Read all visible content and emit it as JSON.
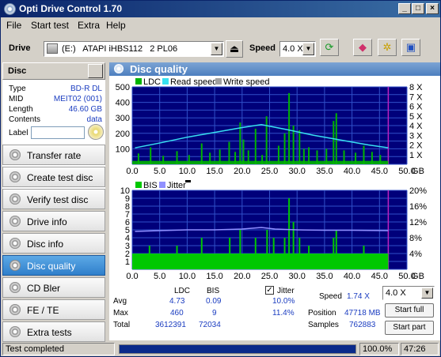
{
  "window": {
    "title": "Opti Drive Control 1.70",
    "min": "_",
    "max": "□",
    "close": "×"
  },
  "menu": [
    "File",
    "Start test",
    "Extra",
    "Help"
  ],
  "toolbar": {
    "drive_label": "Drive",
    "drive_value": "(E:)   ATAPI iHBS112   2 PL06",
    "speed_label": "Speed",
    "speed_value": "4.0 X"
  },
  "disc": {
    "header": "Disc",
    "rows": [
      {
        "key": "Type",
        "value": "BD-R DL"
      },
      {
        "key": "MID",
        "value": "MEIT02 (001)"
      },
      {
        "key": "Length",
        "value": "46.60 GB"
      },
      {
        "key": "Contents",
        "value": "data"
      }
    ],
    "label_key": "Label",
    "label_value": ""
  },
  "nav": [
    {
      "label": "Transfer rate",
      "active": false
    },
    {
      "label": "Create test disc",
      "active": false
    },
    {
      "label": "Verify test disc",
      "active": false
    },
    {
      "label": "Drive info",
      "active": false
    },
    {
      "label": "Disc info",
      "active": false
    },
    {
      "label": "Disc quality",
      "active": true
    },
    {
      "label": "CD Bler",
      "active": false
    },
    {
      "label": "FE / TE",
      "active": false
    },
    {
      "label": "Extra tests",
      "active": false
    }
  ],
  "panel_title": "Disc quality",
  "colors": {
    "ldc": "#00b400",
    "read_speed": "#38e0f0",
    "write_speed": "#a0a0a0",
    "bis": "#00c800",
    "jitter": "#9090ff",
    "plot_bg": "#00007a",
    "grid": "#3050c8"
  },
  "chart_data": [
    {
      "type": "bar",
      "legend": [
        "LDC",
        "Read speed",
        "Write speed"
      ],
      "xlabel": "GB",
      "xticks": [
        "0.0",
        "5.0",
        "10.0",
        "15.0",
        "20.0",
        "25.0",
        "30.0",
        "35.0",
        "40.0",
        "45.0",
        "50.0"
      ],
      "xlim": [
        0,
        50
      ],
      "ylim": [
        0,
        500
      ],
      "yticks": [
        "500",
        "400",
        "300",
        "200",
        "100"
      ],
      "y2ticks": [
        "8 X",
        "7 X",
        "6 X",
        "5 X",
        "4 X",
        "3 X",
        "2 X",
        "1 X"
      ],
      "y2lim": [
        0,
        8
      ],
      "ldc_spikes": [
        {
          "x": 1.0,
          "y": 70
        },
        {
          "x": 3.2,
          "y": 110
        },
        {
          "x": 5.5,
          "y": 55
        },
        {
          "x": 8.0,
          "y": 85
        },
        {
          "x": 10.2,
          "y": 60
        },
        {
          "x": 12.5,
          "y": 135
        },
        {
          "x": 14.0,
          "y": 75
        },
        {
          "x": 15.8,
          "y": 95
        },
        {
          "x": 17.5,
          "y": 145
        },
        {
          "x": 18.6,
          "y": 80
        },
        {
          "x": 19.5,
          "y": 270
        },
        {
          "x": 20.1,
          "y": 160
        },
        {
          "x": 21.0,
          "y": 90
        },
        {
          "x": 22.3,
          "y": 230
        },
        {
          "x": 23.5,
          "y": 60
        },
        {
          "x": 24.3,
          "y": 310
        },
        {
          "x": 26.5,
          "y": 120
        },
        {
          "x": 27.6,
          "y": 200
        },
        {
          "x": 28.4,
          "y": 460
        },
        {
          "x": 29.2,
          "y": 250
        },
        {
          "x": 30.3,
          "y": 220
        },
        {
          "x": 31.1,
          "y": 100
        },
        {
          "x": 32.0,
          "y": 110
        },
        {
          "x": 33.5,
          "y": 90
        },
        {
          "x": 35.2,
          "y": 100
        },
        {
          "x": 36.5,
          "y": 280
        },
        {
          "x": 37.0,
          "y": 330
        },
        {
          "x": 38.4,
          "y": 90
        },
        {
          "x": 40.5,
          "y": 75
        },
        {
          "x": 42.0,
          "y": 120
        },
        {
          "x": 43.5,
          "y": 80
        },
        {
          "x": 45.0,
          "y": 60
        }
      ],
      "ldc_baseline": 22,
      "read_speed": [
        {
          "x": 0.5,
          "y": 1.7
        },
        {
          "x": 5,
          "y": 2.2
        },
        {
          "x": 10,
          "y": 2.8
        },
        {
          "x": 15,
          "y": 3.3
        },
        {
          "x": 20,
          "y": 3.8
        },
        {
          "x": 23.5,
          "y": 4.1
        },
        {
          "x": 28,
          "y": 3.6
        },
        {
          "x": 33,
          "y": 3.0
        },
        {
          "x": 38,
          "y": 2.5
        },
        {
          "x": 43,
          "y": 2.0
        },
        {
          "x": 46.6,
          "y": 1.7
        }
      ]
    },
    {
      "type": "bar",
      "legend": [
        "BIS",
        "Jitter"
      ],
      "xlabel": "GB",
      "xticks": [
        "0.0",
        "5.0",
        "10.0",
        "15.0",
        "20.0",
        "25.0",
        "30.0",
        "35.0",
        "40.0",
        "45.0",
        "50.0"
      ],
      "xlim": [
        0,
        50
      ],
      "ylim": [
        0,
        10
      ],
      "yticks": [
        "10",
        "9",
        "8",
        "7",
        "6",
        "5",
        "4",
        "3",
        "2",
        "1"
      ],
      "y2ticks": [
        "20%",
        "16%",
        "12%",
        "8%",
        "4%"
      ],
      "y2lim": [
        0,
        20
      ],
      "bis_level": 2,
      "bis_spikes": [
        {
          "x": 3.0,
          "y": 3
        },
        {
          "x": 8.0,
          "y": 3
        },
        {
          "x": 12.5,
          "y": 4
        },
        {
          "x": 17.6,
          "y": 4
        },
        {
          "x": 19.5,
          "y": 5
        },
        {
          "x": 22.3,
          "y": 4
        },
        {
          "x": 24.4,
          "y": 5
        },
        {
          "x": 25.6,
          "y": 4
        },
        {
          "x": 27.6,
          "y": 4
        },
        {
          "x": 28.4,
          "y": 9
        },
        {
          "x": 29.2,
          "y": 6
        },
        {
          "x": 30.3,
          "y": 4
        },
        {
          "x": 32.0,
          "y": 3
        },
        {
          "x": 36.5,
          "y": 4
        },
        {
          "x": 37.0,
          "y": 5
        },
        {
          "x": 42.0,
          "y": 3
        }
      ],
      "jitter": [
        {
          "x": 0.5,
          "y": 9.6
        },
        {
          "x": 5,
          "y": 9.8
        },
        {
          "x": 10,
          "y": 10.0
        },
        {
          "x": 15,
          "y": 10.0
        },
        {
          "x": 20,
          "y": 10.2
        },
        {
          "x": 23.5,
          "y": 10.6
        },
        {
          "x": 26,
          "y": 10.2
        },
        {
          "x": 30,
          "y": 10.0
        },
        {
          "x": 35,
          "y": 9.9
        },
        {
          "x": 40,
          "y": 9.9
        },
        {
          "x": 46.6,
          "y": 9.8
        }
      ]
    }
  ],
  "stats": {
    "col_ldc": "LDC",
    "col_bis": "BIS",
    "jitter_label": "Jitter",
    "jitter_checked": true,
    "avg_label": "Avg",
    "avg_ldc": "4.73",
    "avg_bis": "0.09",
    "avg_jitter": "10.0%",
    "max_label": "Max",
    "max_ldc": "460",
    "max_bis": "9",
    "max_jitter": "11.4%",
    "total_label": "Total",
    "total_ldc": "3612391",
    "total_bis": "72034",
    "speed_label": "Speed",
    "speed_value": "1.74 X",
    "speed_select": "4.0 X",
    "position_label": "Position",
    "position_value": "47718 MB",
    "samples_label": "Samples",
    "samples_value": "762883",
    "start_full": "Start full",
    "start_part": "Start part"
  },
  "status": {
    "text": "Test completed",
    "progress": 1.0,
    "percent": "100.0%",
    "time": "47:26"
  }
}
